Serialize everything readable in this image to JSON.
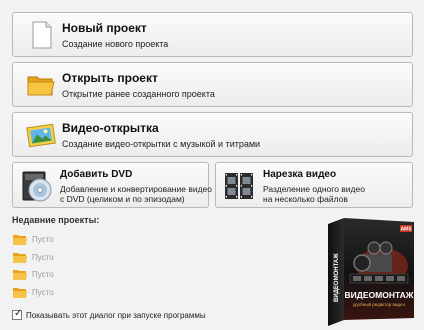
{
  "buttons": {
    "new_project": {
      "title": "Новый проект",
      "desc": "Создание нового проекта",
      "icon": "blank-document-icon"
    },
    "open_project": {
      "title": "Открыть проект",
      "desc": "Открытие ранее созданного проекта",
      "icon": "folder-icon"
    },
    "postcard": {
      "title": "Видео-открытка",
      "desc": "Создание видео-открытки с музыкой и титрами",
      "icon": "postcard-picture-icon"
    },
    "add_dvd": {
      "title": "Добавить DVD",
      "desc_line1": "Добавление и конвертирование видео",
      "desc_line2": "с DVD (целиком и по эпизодам)",
      "icon": "dvd-disc-icon"
    },
    "cut_video": {
      "title": "Нарезка видео",
      "desc_line1": "Разделение одного видео",
      "desc_line2": "на несколько файлов",
      "icon": "film-strip-icon"
    }
  },
  "recent": {
    "title": "Недавние проекты:",
    "items": [
      {
        "label": "Пусто",
        "icon": "folder-icon"
      },
      {
        "label": "Пусто",
        "icon": "folder-icon"
      },
      {
        "label": "Пусто",
        "icon": "folder-icon"
      },
      {
        "label": "Пусто",
        "icon": "folder-icon"
      }
    ]
  },
  "startup_checkbox": {
    "label": "Показывать этот диалог при запуске программы",
    "checked": true,
    "mark": "✓"
  },
  "product_box": {
    "brand": "AMS",
    "name": "ВИДЕОМОНТАЖ",
    "tagline": "удобный редактор видео",
    "spine": "ВИДЕОМОНТАЖ"
  },
  "colors": {
    "folder": "#f0b629",
    "box_dark": "#1c1c1c",
    "box_red": "#c8331e"
  }
}
